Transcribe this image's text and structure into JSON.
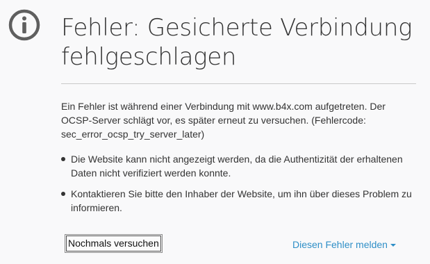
{
  "error_page": {
    "icon": "info-icon",
    "title": "Fehler: Gesicherte Verbindung fehlgeschlagen",
    "description": "Ein Fehler ist während einer Verbindung mit www.b4x.com aufgetreten. Der OCSP-Server schlägt vor, es später erneut zu versuchen. (Fehlercode: sec_error_ocsp_try_server_later)",
    "bullets": [
      "Die Website kann nicht angezeigt werden, da die Authentizität der erhaltenen Daten nicht verifiziert werden konnte.",
      "Kontaktieren Sie bitte den Inhaber der Website, um ihn über dieses Problem zu informieren."
    ],
    "retry_label": "Nochmals versuchen",
    "report_label": "Diesen Fehler melden",
    "report_icon": "caret-down-icon"
  },
  "colors": {
    "background": "#f9f9fa",
    "text": "#333333",
    "link": "#2f8fc7",
    "icon": "#5f5f5f"
  }
}
